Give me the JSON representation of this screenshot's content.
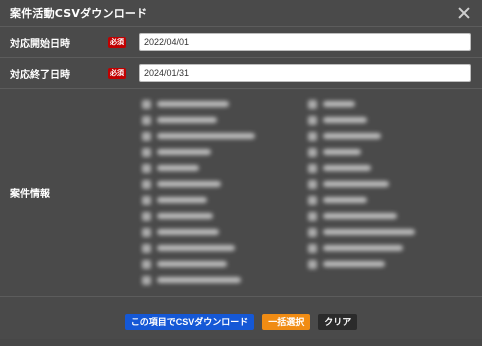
{
  "dialog": {
    "title": "案件活動CSVダウンロード"
  },
  "form": {
    "start": {
      "label": "対応開始日時",
      "required": "必須",
      "value": "2022/04/01"
    },
    "end": {
      "label": "対応終了日時",
      "required": "必須",
      "value": "2024/01/31"
    },
    "case_info": {
      "label": "案件情報"
    }
  },
  "footer": {
    "download": "この項目でCSVダウンロード",
    "select_all": "一括選択",
    "clear": "クリア"
  },
  "colors": {
    "modal_bg": "#4a4a4a",
    "required_badge": "#c00000",
    "primary_button": "#1558d6",
    "select_all_button": "#f08c14",
    "clear_button": "#2b2b2b"
  }
}
